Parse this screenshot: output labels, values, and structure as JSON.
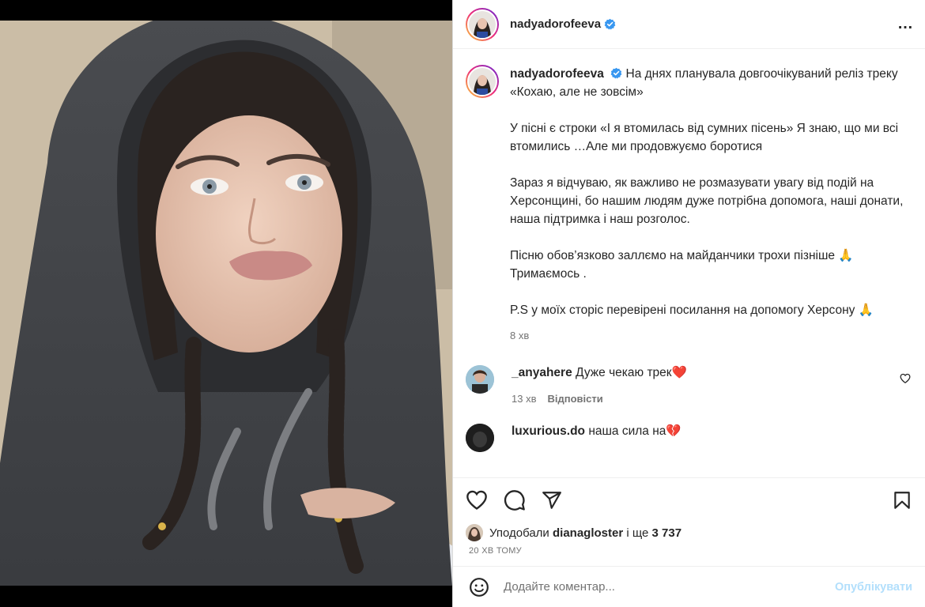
{
  "post": {
    "username": "nadyadorofeeva",
    "more_icon": "…",
    "caption_line1": "На днях планувала довгоочікуваний реліз треку «Кохаю, але не зовсім»",
    "caption_p2": "У пісні є строки «І я втомилась від сумних пісень» Я знаю, що ми всі втомились …Але ми продовжуємо боротися",
    "caption_p3": "Зараз я відчуваю, як важливо не розмазувати увагу від подій на Херсонщині, бо нашим людям дуже потрібна допомога, наші донати, наша підтримка і наш розголос.",
    "caption_p4": "Пісню обов’язково заллємо на майданчики трохи пізніше 🙏 Тримаємось .",
    "caption_p5": "P.S у моїх сторіс перевірені посилання на допомогу Херсону 🙏",
    "time": "8 хв"
  },
  "comments": [
    {
      "username": "_anyahere",
      "text": "Дуже чекаю трек",
      "emoji": "❤️",
      "time": "13 хв",
      "reply": "Відповісти"
    },
    {
      "username": "luxurious.do",
      "text": "наша сила на",
      "emoji": "💔"
    }
  ],
  "likes": {
    "prefix": "Уподобали",
    "user": "dianagloster",
    "suffix": "і ще",
    "count": "3 737"
  },
  "posted_ago": "20 ХВ ТОМУ",
  "add_comment": {
    "placeholder": "Додайте коментар...",
    "post_label": "Опублікувати"
  },
  "colors": {
    "verified": "#3897f0",
    "link_disabled": "#b2dffc",
    "muted": "#737373"
  }
}
